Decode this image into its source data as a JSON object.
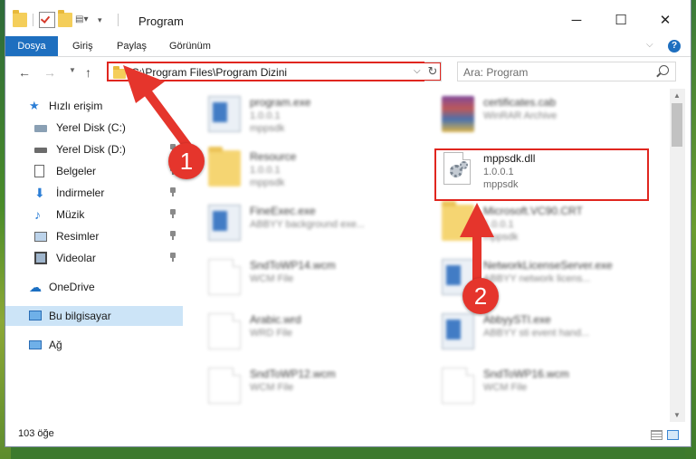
{
  "window": {
    "title": "Program",
    "minimize_glyph": "─",
    "maximize_glyph": "☐",
    "close_glyph": "✕"
  },
  "ribbon": {
    "tabs": [
      "Dosya",
      "Giriş",
      "Paylaş",
      "Görünüm"
    ],
    "help_glyph": "?"
  },
  "nav": {
    "address": "C:\\Program Files\\Program Dizini",
    "search_placeholder": "Ara: Program",
    "back_glyph": "←",
    "forward_glyph": "→",
    "recent_glyph": "▼",
    "up_glyph": "↑",
    "refresh_glyph": "↻",
    "dropdown_glyph": "⌵"
  },
  "sidebar": {
    "items": [
      {
        "label": "Hızlı erişim",
        "icon": "star-icon",
        "pinned": false
      },
      {
        "label": "Yerel Disk (C:)",
        "icon": "drive-icon",
        "pinned": true
      },
      {
        "label": "Yerel Disk (D:)",
        "icon": "drive-icon",
        "pinned": true
      },
      {
        "label": "Belgeler",
        "icon": "documents-icon",
        "pinned": true
      },
      {
        "label": "İndirmeler",
        "icon": "downloads-icon",
        "pinned": true
      },
      {
        "label": "Müzik",
        "icon": "music-icon",
        "pinned": true
      },
      {
        "label": "Resimler",
        "icon": "pictures-icon",
        "pinned": true
      },
      {
        "label": "Videolar",
        "icon": "videos-icon",
        "pinned": true
      },
      {
        "label": "OneDrive",
        "icon": "cloud-icon",
        "pinned": false
      },
      {
        "label": "Bu bilgisayar",
        "icon": "computer-icon",
        "pinned": false,
        "selected": true
      },
      {
        "label": "Ağ",
        "icon": "network-icon",
        "pinned": false
      }
    ]
  },
  "files": [
    {
      "name": "program.exe",
      "line1": "1.0.0.1",
      "line2": "mppsdk",
      "icon": "application-icon"
    },
    {
      "name": "certificates.cab",
      "line1": "WinRAR Archive",
      "line2": "",
      "icon": "archive-icon"
    },
    {
      "name": "Resource",
      "line1": "1.0.0.1",
      "line2": "mppsdk",
      "icon": "folder-icon"
    },
    {
      "name": "mppsdk.dll",
      "line1": "1.0.0.1",
      "line2": "mppsdk",
      "icon": "dll-gear-icon",
      "highlighted": true
    },
    {
      "name": "FineExec.exe",
      "line1": "ABBYY background exe...",
      "line2": "",
      "icon": "application-icon"
    },
    {
      "name": "Microsoft.VC90.CRT",
      "line1": "1.0.0.1",
      "line2": "mppsdk",
      "icon": "folder-icon"
    },
    {
      "name": "SndToWP14.wcm",
      "line1": "WCM File",
      "line2": "",
      "icon": "document-icon"
    },
    {
      "name": "NetworkLicenseServer.exe",
      "line1": "ABBYY network licens...",
      "line2": "",
      "icon": "application-icon"
    },
    {
      "name": "Arabic.wrd",
      "line1": "WRD File",
      "line2": "",
      "icon": "document-icon"
    },
    {
      "name": "AbbyySTI.exe",
      "line1": "ABBYY sti event hand...",
      "line2": "",
      "icon": "application-icon"
    },
    {
      "name": "SndToWP12.wcm",
      "line1": "WCM File",
      "line2": "",
      "icon": "document-icon"
    },
    {
      "name": "SndToWP16.wcm",
      "line1": "WCM File",
      "line2": "",
      "icon": "document-icon"
    }
  ],
  "status": {
    "item_count": "103 öğe"
  },
  "annotations": {
    "badge1": "1",
    "badge2": "2",
    "color": "#e5352c"
  }
}
